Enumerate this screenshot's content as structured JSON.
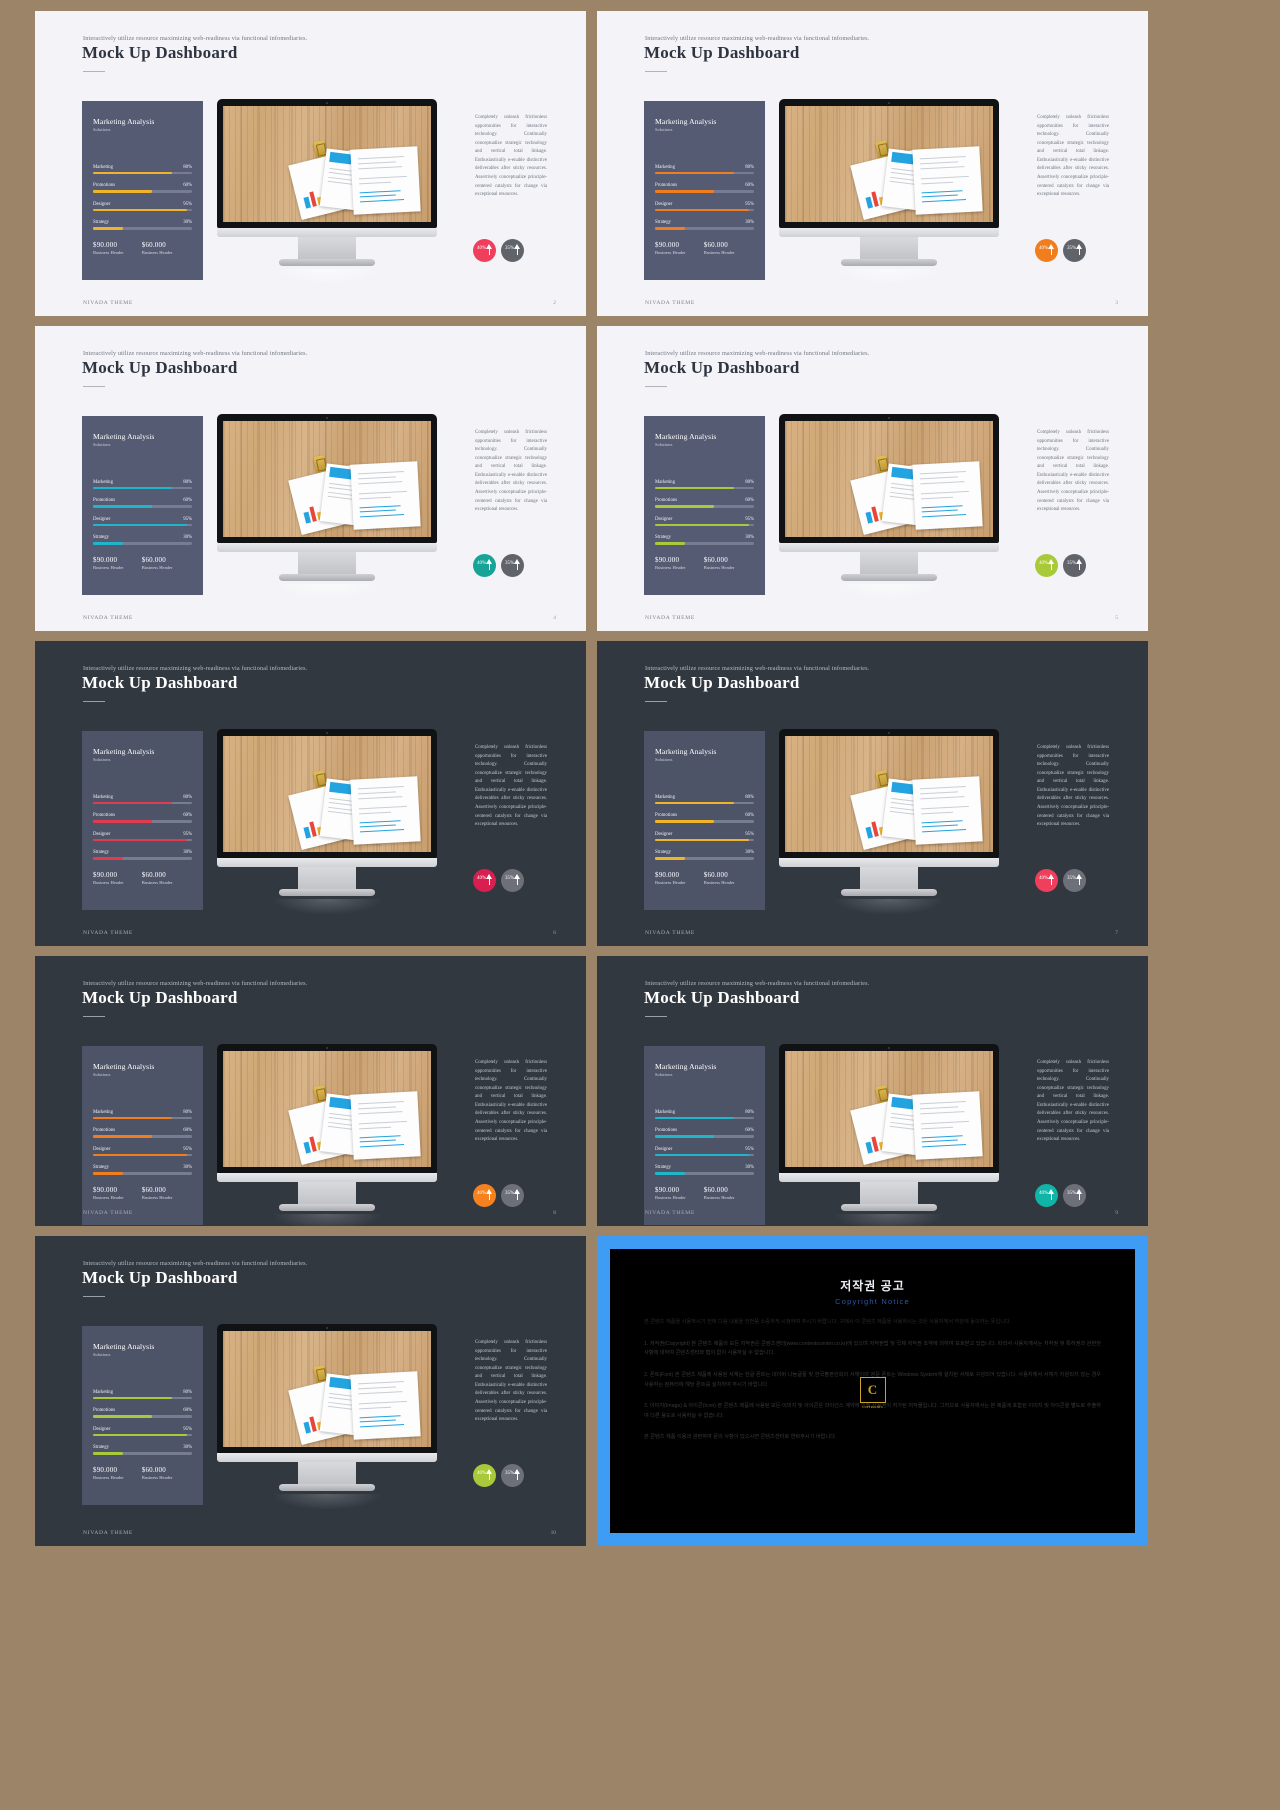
{
  "deck": {
    "background_color": "#9c8468",
    "eyebrow": "Interactively utilize resource maximizing web-readiness via functional infomediaries.",
    "title": "Mock Up Dashboard",
    "footer": "NIVADA THEME",
    "body_paragraph": "Completely unleash frictionless opportunities for interactive technology. Continually conceptualize strategic technology and vertical total linkage. Enthusiastically e-enable distinctive deliverables after sticky resources. Assertively conceptualize principle-centered catalysts for change via exceptional resources.",
    "card": {
      "title": "Marketing Analysis",
      "subtitle": "Solutions",
      "bars": [
        {
          "label": "Marketing",
          "value": "80%",
          "pct": 80
        },
        {
          "label": "Promotions",
          "value": "60%",
          "pct": 60
        },
        {
          "label": "Designer",
          "value": "95%",
          "pct": 95
        },
        {
          "label": "Strategy",
          "value": "30%",
          "pct": 30
        }
      ],
      "stats": [
        {
          "value": "$90.000",
          "label": "Business Header"
        },
        {
          "value": "$60.000",
          "label": "Business Header"
        }
      ]
    },
    "badges": [
      {
        "percent": "40%",
        "icon": "arrow-up-icon"
      },
      {
        "percent": "35%",
        "icon": "arrow-up-icon"
      }
    ]
  },
  "slides": [
    {
      "theme": "light",
      "accent": "#f0b429",
      "badge_color": "#ef3f5c",
      "page": "2"
    },
    {
      "theme": "light",
      "accent": "#f07d1e",
      "badge_color": "#f07d1e",
      "page": "3"
    },
    {
      "theme": "light",
      "accent": "#1fb6c9",
      "badge_color": "#18a398",
      "page": "4"
    },
    {
      "theme": "light",
      "accent": "#a8c93a",
      "badge_color": "#a8c93a",
      "page": "5"
    },
    {
      "theme": "dark",
      "accent": "#e13b52",
      "badge_color": "#d81f50",
      "page": "6"
    },
    {
      "theme": "dark",
      "accent": "#f0b429",
      "badge_color": "#ef3f5c",
      "page": "7"
    },
    {
      "theme": "dark",
      "accent": "#f07d1e",
      "badge_color": "#f5821f",
      "page": "8"
    },
    {
      "theme": "dark",
      "accent": "#1fb6c9",
      "badge_color": "#11b5a8",
      "page": "9"
    },
    {
      "theme": "dark",
      "accent": "#a8c93a",
      "badge_color": "#a8c93a",
      "page": "10"
    }
  ],
  "copyright_slide": {
    "border_color": "#3f9cf5",
    "title": "저작권 공고",
    "subtitle": "Copyright Notice",
    "seal_letter": "C",
    "seal_label": "COPYRIGHTS",
    "paragraphs": [
      "본 콘텐츠 제품을 사용하시기 전에 다음 내용을 한번쯤 소중하게 시청하여 주시기 바랍니다. 구매시 이 콘텐츠 제품을 사용하시는 것은 사용자께서 약관에 동의하는 뜻입니다.",
      "1. 저작권(Copyright) 본 콘텐츠 제품의 모든 저작권은 콘텐츠센터(www.contentscenter.co.kr)에 있으며 저작권법 및 국제 저작권 조약에 의하여 보호받고 있습니다. 따라서 사용자께서는 저작권 및 특허권과 관련한 사항에 대하여 콘텐츠센터와 협의 없이 사용하실 수 없습니다.",
      "2. 폰트(Font) 본 콘텐츠 제품에 사용된 서체는 한글 폰트는 네이버 나눔글꼴 및 한국출판인회의 서체이며 영문 폰트는 Windows System에 설치된 서체로 구성되어 있습니다. 사용자께서 서체가 지원되지 않는 경우 사용하는 컴퓨터에 해당 폰트를 설치하여 주시기 바랍니다.",
      "3. 이미지(Image) & 아이콘(Icon) 본 콘텐츠 제품에 사용된 모든 이미지 및 아이콘은 라이선스 계약에 의해 사용권이 허가된 저작물입니다. 그러므로 사용자께서는 본 제품에 포함된 이미지 및 아이콘을 별도로 추출하여 다른 용도로 사용하실 수 없습니다.",
      "본 콘텐츠 제품 이용과 관련하여 문의 사항이 있으시면 콘텐츠센터로 연락주시기 바랍니다."
    ]
  }
}
